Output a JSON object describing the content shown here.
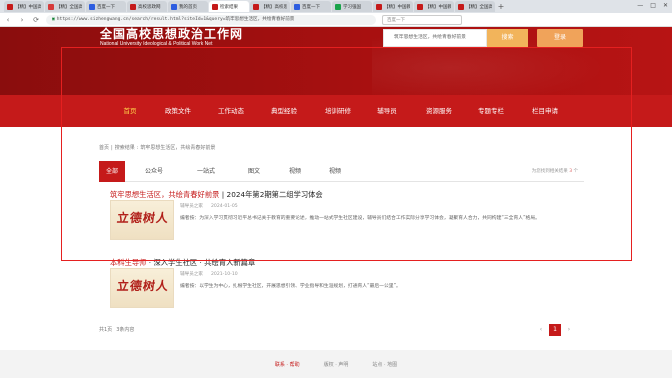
{
  "browser": {
    "tabs": [
      {
        "title": "【精】中国高校思想政治工作网",
        "color": "#c51a1a"
      },
      {
        "title": "【精】全国高校思政网",
        "color": "#d63b3b"
      },
      {
        "title": "百度一下",
        "color": "#2d5de0"
      },
      {
        "title": "高校思政网",
        "color": "#c51a1a"
      },
      {
        "title": "我的首页",
        "color": "#2d5de0"
      },
      {
        "title": "检索结果",
        "color": "#c51a1a"
      },
      {
        "title": "【精】高校思想政治",
        "color": "#c51a1a"
      },
      {
        "title": "百度一下",
        "color": "#2d5de0"
      },
      {
        "title": "学习强国",
        "color": "#19a34a"
      },
      {
        "title": "【精】中国教育",
        "color": "#c51a1a"
      },
      {
        "title": "【精】中国教育报",
        "color": "#c51a1a"
      },
      {
        "title": "【精】全国高校",
        "color": "#c51a1a"
      }
    ],
    "add_tab": "+",
    "window_controls": [
      "—",
      "□",
      "✕"
    ],
    "nav": {
      "back": "‹",
      "forward": "›",
      "reload": "⟳"
    },
    "url": "https://www.sizhengwang.cn/search/result.html?siteId=1&query=筑牢思想生活区，共绘青春好前景",
    "search_placeholder": "百度一下"
  },
  "site": {
    "logo_cn": "全国高校思想政治工作网",
    "logo_en": "National University Ideological & Political Work Net",
    "search_value": "筑牢思想生活区，共绘青春好前景",
    "search_button": "搜索",
    "login_button": "登录"
  },
  "nav": {
    "items": [
      "首页",
      "政策文件",
      "工作动态",
      "典型经验",
      "培训研修",
      "辅导员",
      "资源服务",
      "专题专栏",
      "栏目申请"
    ]
  },
  "breadcrumb": {
    "home": "首页",
    "section": "搜索结果",
    "keyword": "筑牢思想生活区，共绘青春好前景"
  },
  "filter": {
    "tabs": [
      "全部",
      "公众号",
      "一站式",
      "图文",
      "视频",
      "视频"
    ],
    "count_prefix": "为您找到相关结果",
    "count": "3",
    "count_suffix": "个"
  },
  "results": [
    {
      "title_hl": "筑牢思想生活区，共绘青春好前景",
      "title_rest": " | 2024年第2期第二组学习体会",
      "thumb_text": "立德树人",
      "author": "辅导员之家",
      "date": "2024-01-05",
      "summary": "编者按：为深入学习贯彻习近平总书记关于教育的重要论述，推动一站式学生社区建设，辅导员们结合工作实际分享学习体会，凝聚育人合力，共同构建“三全育人”格局。"
    },
    {
      "title_hl": "本科生导师",
      "title_rest": " · 深入学生社区 · 共绘育人新篇章",
      "thumb_text": "立德树人",
      "author": "辅导员之家",
      "date": "2021-10-10",
      "summary": "编者按：以学生为中心，扎根学生社区，开展思想引领、学业指导和生涯规划，打通育人“最后一公里”。"
    }
  ],
  "pager_info": {
    "total": "共1页",
    "items": "3条内容"
  },
  "pager": {
    "prev": "‹",
    "current": "1",
    "next": "›"
  },
  "footer": {
    "link1": "联系 · 帮助",
    "link2": "版权 · 声明",
    "link3": "站点 · 地图"
  },
  "colors": {
    "brand_red": "#c51a1a",
    "header_dark": "#8a0d0d",
    "accent_orange": "#f0a35a",
    "highlight": "#e52020"
  }
}
